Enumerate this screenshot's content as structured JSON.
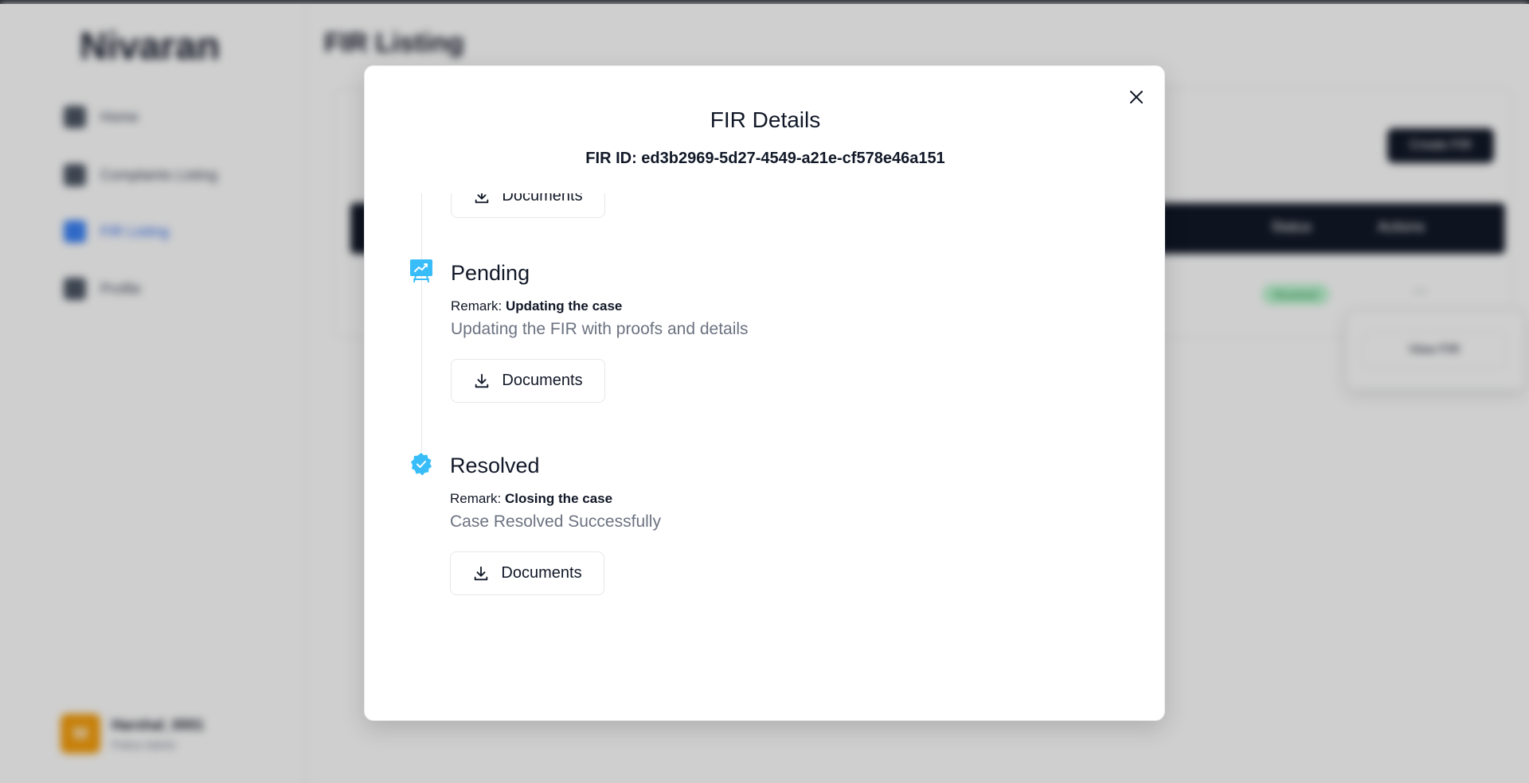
{
  "background": {
    "brand": "Nivaran",
    "nav": [
      {
        "label": "Home"
      },
      {
        "label": "Complaints Listing"
      },
      {
        "label": "FIR Listing"
      },
      {
        "label": "Profile"
      }
    ],
    "user": {
      "initial": "M",
      "name": "Harshal_0001",
      "role": "Police Admin"
    },
    "page_title": "FIR Listing",
    "create_label": "Create FIR",
    "table_headers": {
      "status": "Status",
      "actions": "Actions"
    },
    "row_status": "Resolved",
    "row_actions": "...",
    "menu_item": "View FIR"
  },
  "modal": {
    "title": "FIR Details",
    "fir_id_label": "FIR ID: ed3b2969-5d27-4549-a21e-cf578e46a151",
    "close_icon": "close-icon",
    "timeline": [
      {
        "documents_label": "Documents"
      },
      {
        "title": "Pending",
        "icon": "presentation-chart-icon",
        "remark_label": "Remark:",
        "remark": "Updating the case",
        "description": "Updating the FIR with proofs and details",
        "documents_label": "Documents"
      },
      {
        "title": "Resolved",
        "icon": "check-badge-icon",
        "remark_label": "Remark:",
        "remark": "Closing the case",
        "description": "Case Resolved Successfully",
        "documents_label": "Documents"
      }
    ],
    "accent_color": "#38bdf8"
  }
}
